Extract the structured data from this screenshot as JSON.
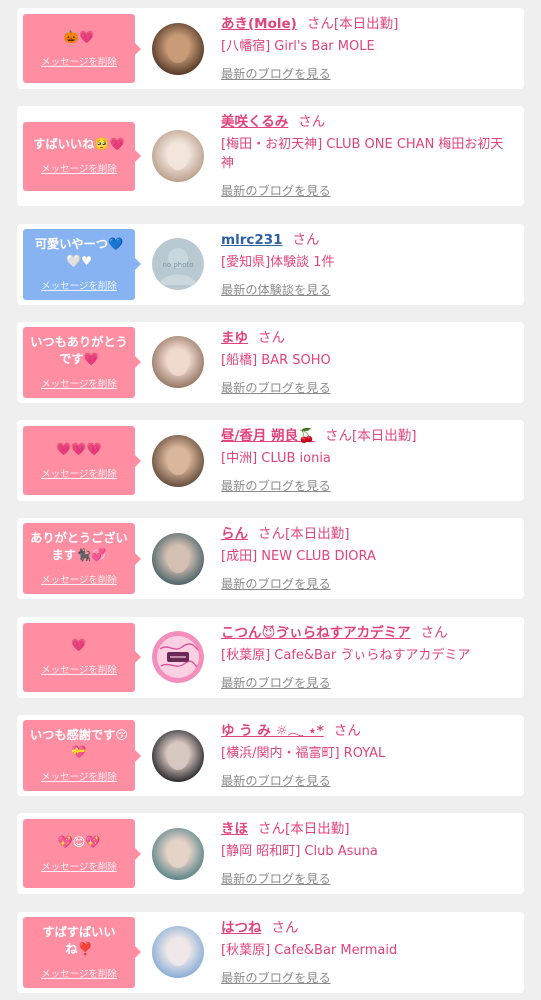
{
  "colors": {
    "page_background": "#efefef",
    "card_background": "#ffffff",
    "name_pink": "#e1437b",
    "name_blue": "#2c5fa6",
    "link_gray": "#8b8b8b"
  },
  "messages": [
    {
      "bubble": {
        "text": "🎃💗",
        "delete_label": "メッセージを削除",
        "color": "#ff8ea2"
      },
      "avatar": {
        "c1": "#c99c77",
        "c2": "#4b3022"
      },
      "name": "あき(Mole)",
      "honorific": "さん",
      "status": "[本日出勤]",
      "shop": "[八幡宿] Girl's Bar MOLE",
      "link_label": "最新のブログを見る"
    },
    {
      "bubble": {
        "text": "すばいいね🥺💗",
        "delete_label": "メッセージを削除",
        "color": "#ff8ea2"
      },
      "avatar": {
        "c1": "#f1e4dc",
        "c2": "#b79a86"
      },
      "name": "美咲くるみ",
      "honorific": "さん",
      "shop": "[梅田・お初天神] CLUB ONE CHAN 梅田お初天神",
      "link_label": "最新のブログを見る"
    },
    {
      "bubble": {
        "text": "可愛いやーつ💙🤍♥",
        "delete_label": "メッセージを削除",
        "color": "#87b3f2"
      },
      "avatar": {
        "no_photo_label": "no photo"
      },
      "name": "mlrc231",
      "honorific": "さん",
      "shop": "[愛知県]体験談 1件",
      "link_label": "最新の体験談を見る"
    },
    {
      "bubble": {
        "text": "いつもありがとうです💗",
        "delete_label": "メッセージを削除",
        "color": "#ff8ea2"
      },
      "avatar": {
        "c1": "#efd9cc",
        "c2": "#8e6e5c"
      },
      "name": "まゆ",
      "honorific": "さん",
      "shop": "[船橋] BAR SOHO",
      "link_label": "最新のブログを見る"
    },
    {
      "bubble": {
        "text": "💗💗💗",
        "delete_label": "メッセージを削除",
        "color": "#ff8ea2"
      },
      "avatar": {
        "c1": "#d9b79b",
        "c2": "#5e4536"
      },
      "name": "昼/香月 朔良🍒",
      "honorific": "さん",
      "status": "[本日出勤]",
      "shop": "[中洲] CLUB ionia",
      "link_label": "最新のブログを見る"
    },
    {
      "bubble": {
        "text": "ありがとうございます🐈‍⬛💞",
        "delete_label": "メッセージを削除",
        "color": "#ff8ea2"
      },
      "avatar": {
        "c1": "#d5c1b4",
        "c2": "#3f5c63"
      },
      "name": "らん",
      "honorific": "さん",
      "status": "[本日出勤]",
      "shop": "[成田] NEW CLUB DIORA",
      "link_label": "最新のブログを見る"
    },
    {
      "bubble": {
        "text": "💗",
        "delete_label": "メッセージを削除",
        "color": "#ff8ea2"
      },
      "avatar": {
        "c1": "#fbd0e3",
        "c2": "#f48fbd"
      },
      "name": "こつん😈ゔぃらねすアカデミア",
      "honorific": "さん",
      "shop": "[秋葉原] Cafe&Bar ゔぃらねすアカデミア",
      "link_label": "最新のブログを見る"
    },
    {
      "bubble": {
        "text": "いつも感謝です😚💝",
        "delete_label": "メッセージを削除",
        "color": "#ff8ea2"
      },
      "avatar": {
        "c1": "#d8c8c2",
        "c2": "#1e1e22"
      },
      "name": "ゆ う み ☼𓂃 ⋆*",
      "honorific": "さん",
      "shop": "[横浜/関内・福富町] ROYAL",
      "link_label": "最新のブログを見る"
    },
    {
      "bubble": {
        "text": "💖😊💖",
        "delete_label": "メッセージを削除",
        "color": "#ff8ea2"
      },
      "avatar": {
        "c1": "#e6d3c8",
        "c2": "#4f7f86"
      },
      "name": "きほ",
      "honorific": "さん",
      "status": "[本日出勤]",
      "shop": "[静岡 昭和町] Club Asuna",
      "link_label": "最新のブログを見る"
    },
    {
      "bubble": {
        "text": "すばすばいいね❣️",
        "delete_label": "メッセージを削除",
        "color": "#ff8ea2"
      },
      "avatar": {
        "c1": "#f0e8e8",
        "c2": "#7fa9d6"
      },
      "name": "はつね",
      "honorific": "さん",
      "shop": "[秋葉原] Cafe&Bar Mermaid",
      "link_label": "最新のブログを見る"
    }
  ]
}
